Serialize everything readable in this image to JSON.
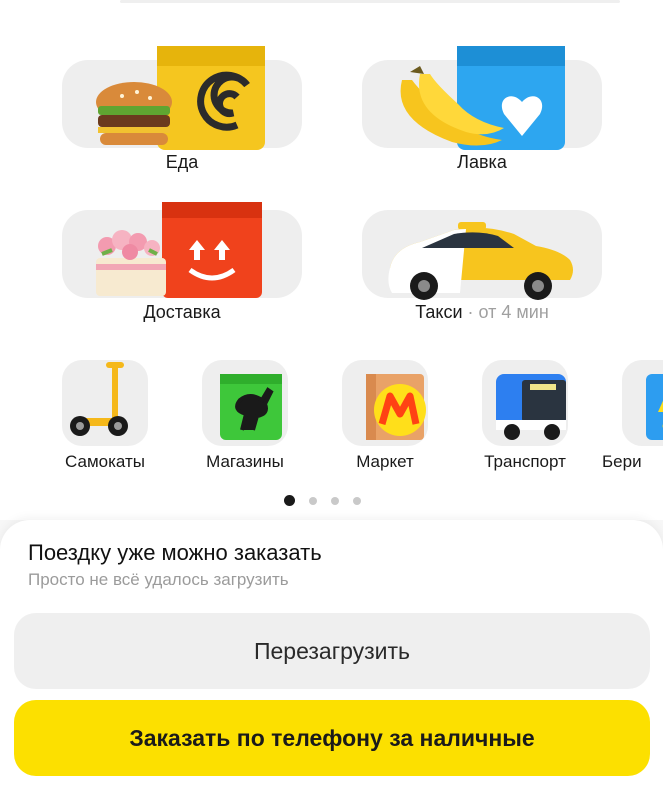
{
  "services": {
    "eda": {
      "label": "Еда"
    },
    "lavka": {
      "label": "Лавка"
    },
    "dostavka": {
      "label": "Доставка"
    },
    "taxi": {
      "label": "Такси",
      "eta": "· от 4 мин"
    }
  },
  "shortcuts": [
    {
      "label": "Самокаты",
      "icon": "scooter-icon"
    },
    {
      "label": "Магазины",
      "icon": "ostrich-bag-icon"
    },
    {
      "label": "Маркет",
      "icon": "market-m-icon"
    },
    {
      "label": "Транспорт",
      "icon": "bus-icon"
    },
    {
      "label": "Бери",
      "icon": "powerbank-icon"
    }
  ],
  "pager": {
    "pages": 4,
    "active": 1
  },
  "sheet": {
    "title": "Поездку уже можно заказать",
    "subtitle": "Просто не всё удалось загрузить",
    "reload_label": "Перезагрузить",
    "order_label": "Заказать по телефону за наличные"
  },
  "colors": {
    "accent": "#fce000",
    "background": "#f7f7f7"
  }
}
